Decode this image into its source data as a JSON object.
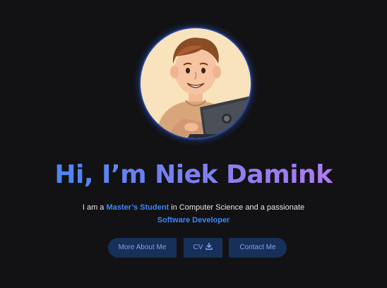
{
  "hero": {
    "greeting": "Hi, I’m Niek Damink",
    "intro_prefix": "I am a ",
    "role_highlight": "Master’s Student",
    "intro_middle": " in Computer Science and a passionate ",
    "skill_highlight": "Software Developer",
    "avatar_icon": "cartoon-avatar-with-laptop"
  },
  "buttons": {
    "about_label": "More About Me",
    "cv_label": "CV",
    "cv_icon": "download-icon",
    "contact_label": "Contact Me"
  },
  "colors": {
    "background": "#121214",
    "accent_blue": "#3f86f5",
    "gradient_start": "#4a86f2",
    "gradient_end": "#b07cf2",
    "button_bg": "#17305a",
    "button_text": "#7fa4e8"
  }
}
